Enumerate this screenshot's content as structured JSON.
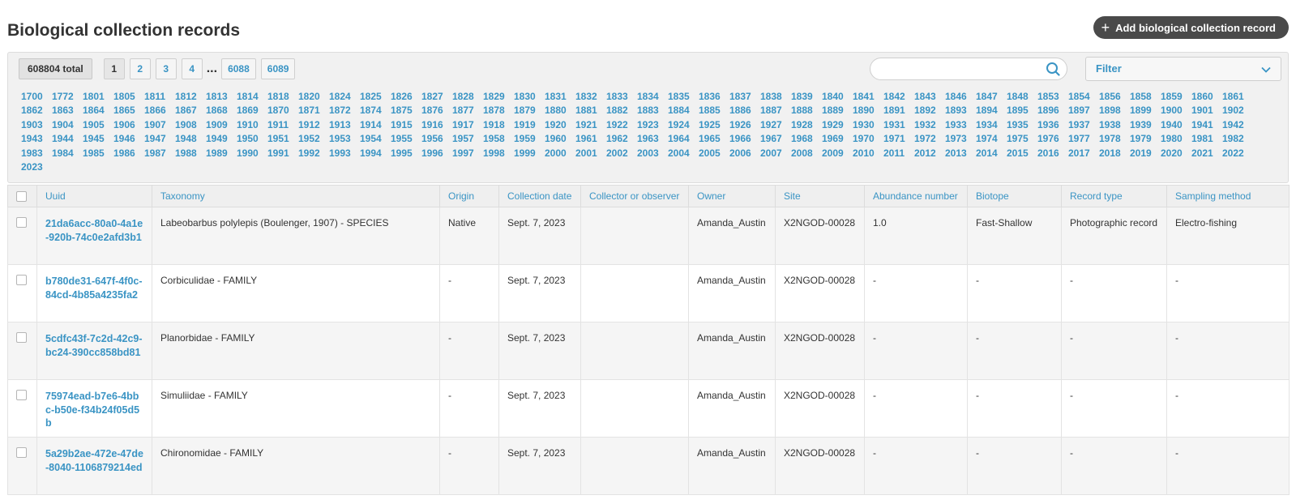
{
  "header": {
    "title": "Biological collection records",
    "add_button_label": "Add biological collection record"
  },
  "pagination": {
    "total": "608804 total",
    "pages": [
      "1",
      "2",
      "3",
      "4"
    ],
    "ellipsis": "...",
    "last_pages": [
      "6088",
      "6089"
    ]
  },
  "search": {
    "value": "",
    "placeholder": ""
  },
  "filter": {
    "label": "Filter"
  },
  "years": [
    "1700",
    "1772",
    "1801",
    "1805",
    "1811",
    "1812",
    "1813",
    "1814",
    "1818",
    "1820",
    "1824",
    "1825",
    "1826",
    "1827",
    "1828",
    "1829",
    "1830",
    "1831",
    "1832",
    "1833",
    "1834",
    "1835",
    "1836",
    "1837",
    "1838",
    "1839",
    "1840",
    "1841",
    "1842",
    "1843",
    "1846",
    "1847",
    "1848",
    "1853",
    "1854",
    "1856",
    "1858",
    "1859",
    "1860",
    "1861",
    "1862",
    "1863",
    "1864",
    "1865",
    "1866",
    "1867",
    "1868",
    "1869",
    "1870",
    "1871",
    "1872",
    "1874",
    "1875",
    "1876",
    "1877",
    "1878",
    "1879",
    "1880",
    "1881",
    "1882",
    "1883",
    "1884",
    "1885",
    "1886",
    "1887",
    "1888",
    "1889",
    "1890",
    "1891",
    "1892",
    "1893",
    "1894",
    "1895",
    "1896",
    "1897",
    "1898",
    "1899",
    "1900",
    "1901",
    "1902",
    "1903",
    "1904",
    "1905",
    "1906",
    "1907",
    "1908",
    "1909",
    "1910",
    "1911",
    "1912",
    "1913",
    "1914",
    "1915",
    "1916",
    "1917",
    "1918",
    "1919",
    "1920",
    "1921",
    "1922",
    "1923",
    "1924",
    "1925",
    "1926",
    "1927",
    "1928",
    "1929",
    "1930",
    "1931",
    "1932",
    "1933",
    "1934",
    "1935",
    "1936",
    "1937",
    "1938",
    "1939",
    "1940",
    "1941",
    "1942",
    "1943",
    "1944",
    "1945",
    "1946",
    "1947",
    "1948",
    "1949",
    "1950",
    "1951",
    "1952",
    "1953",
    "1954",
    "1955",
    "1956",
    "1957",
    "1958",
    "1959",
    "1960",
    "1961",
    "1962",
    "1963",
    "1964",
    "1965",
    "1966",
    "1967",
    "1968",
    "1969",
    "1970",
    "1971",
    "1972",
    "1973",
    "1974",
    "1975",
    "1976",
    "1977",
    "1978",
    "1979",
    "1980",
    "1981",
    "1982",
    "1983",
    "1984",
    "1985",
    "1986",
    "1987",
    "1988",
    "1989",
    "1990",
    "1991",
    "1992",
    "1993",
    "1994",
    "1995",
    "1996",
    "1997",
    "1998",
    "1999",
    "2000",
    "2001",
    "2002",
    "2003",
    "2004",
    "2005",
    "2006",
    "2007",
    "2008",
    "2009",
    "2010",
    "2011",
    "2012",
    "2013",
    "2014",
    "2015",
    "2016",
    "2017",
    "2018",
    "2019",
    "2020",
    "2021",
    "2022",
    "2023"
  ],
  "table": {
    "columns": [
      "Uuid",
      "Taxonomy",
      "Origin",
      "Collection date",
      "Collector or observer",
      "Owner",
      "Site",
      "Abundance number",
      "Biotope",
      "Record type",
      "Sampling method"
    ],
    "rows": [
      [
        "21da6acc-80a0-4a1e-920b-74c0e2afd3b1",
        "Labeobarbus polylepis (Boulenger, 1907) - SPECIES",
        "Native",
        "Sept. 7, 2023",
        "",
        "Amanda_Austin",
        "X2NGOD-00028",
        "1.0",
        "Fast-Shallow",
        "Photographic record",
        "Electro-fishing"
      ],
      [
        "b780de31-647f-4f0c-84cd-4b85a4235fa2",
        "Corbiculidae - FAMILY",
        "-",
        "Sept. 7, 2023",
        "",
        "Amanda_Austin",
        "X2NGOD-00028",
        "-",
        "-",
        "-",
        "-"
      ],
      [
        "5cdfc43f-7c2d-42c9-bc24-390cc858bd81",
        "Planorbidae - FAMILY",
        "-",
        "Sept. 7, 2023",
        "",
        "Amanda_Austin",
        "X2NGOD-00028",
        "-",
        "-",
        "-",
        "-"
      ],
      [
        "75974ead-b7e6-4bbc-b50e-f34b24f05d5b",
        "Simuliidae - FAMILY",
        "-",
        "Sept. 7, 2023",
        "",
        "Amanda_Austin",
        "X2NGOD-00028",
        "-",
        "-",
        "-",
        "-"
      ],
      [
        "5a29b2ae-472e-47de-8040-1106879214ed",
        "Chironomidae - FAMILY",
        "-",
        "Sept. 7, 2023",
        "",
        "Amanda_Austin",
        "X2NGOD-00028",
        "-",
        "-",
        "-",
        "-"
      ]
    ]
  }
}
